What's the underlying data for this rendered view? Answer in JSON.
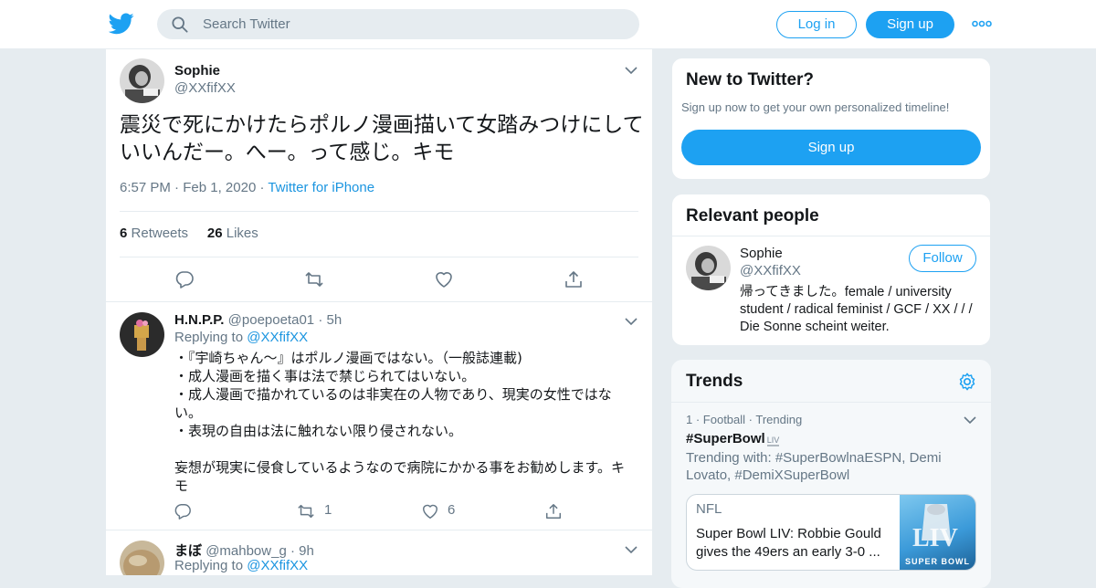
{
  "header": {
    "search_placeholder": "Search Twitter",
    "login_label": "Log in",
    "signup_label": "Sign up"
  },
  "tweet": {
    "name": "Sophie",
    "handle": "@XXfifXX",
    "text": "震災で死にかけたらポルノ漫画描いて女踏みつけにしていいんだー。へー。って感じ。キモ",
    "time": "6:57 PM",
    "date": "Feb 1, 2020",
    "source": "Twitter for iPhone",
    "retweets": "6",
    "retweets_label": "Retweets",
    "likes": "26",
    "likes_label": "Likes"
  },
  "replies": [
    {
      "name": "H.N.P.P.",
      "handle": "@poepoeta01",
      "age": "5h",
      "replying_label": "Replying to",
      "replying_to": "@XXfifXX",
      "text": "・『宇崎ちゃん～』はポルノ漫画ではない。（一般誌連載)\n・成人漫画を描く事は法で禁じられてはいない。\n・成人漫画で描かれているのは非実在の人物であり、現実の女性ではない。\n・表現の自由は法に触れない限り侵されない。\n\n妄想が現実に侵食しているようなので病院にかかる事をお勧めします。キモ",
      "retweets": "1",
      "likes": "6"
    },
    {
      "name": "まぼ",
      "handle": "@mahbow_g",
      "age": "9h",
      "replying_label": "Replying to",
      "replying_to": "@XXfifXX"
    }
  ],
  "signup_card": {
    "title": "New to Twitter?",
    "subtitle": "Sign up now to get your own personalized timeline!",
    "button": "Sign up"
  },
  "relevant": {
    "title": "Relevant people",
    "name": "Sophie",
    "handle": "@XXfifXX",
    "follow": "Follow",
    "bio": "帰ってきました。female / university student / radical feminist / GCF / XX / / / Die Sonne scheint weiter."
  },
  "trends": {
    "title": "Trends",
    "rank": "1",
    "category": "Football",
    "status": "Trending",
    "name": "#SuperBowl",
    "emoji_label": "LIV",
    "trending_with": "Trending with: #SuperBowlnaESPN, Demi Lovato, #DemiXSuperBowl",
    "news_source": "NFL",
    "news_title": "Super Bowl LIV: Robbie Gould gives the 49ers an early 3-0 ...",
    "news_thumb_text": "SUPER BOWL"
  },
  "colors": {
    "accent": "#1da1f2",
    "link": "#1b95e0",
    "muted": "#657786"
  }
}
